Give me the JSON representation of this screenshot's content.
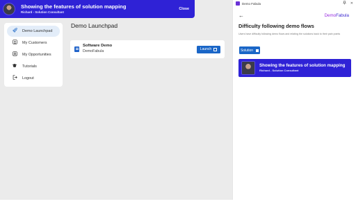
{
  "banner": {
    "title": "Showing the features of solution mapping",
    "subtitle": "Richard - Solution Consultant",
    "close_label": "Close"
  },
  "sidebar": {
    "items": [
      {
        "label": "Demo Launchpad",
        "icon": "rocket-icon",
        "active": true
      },
      {
        "label": "My Customers",
        "icon": "customers-icon",
        "active": false
      },
      {
        "label": "My Opportunities",
        "icon": "opportunities-icon",
        "active": false
      },
      {
        "label": "Tutorials",
        "icon": "graduation-cap-icon",
        "active": false
      },
      {
        "label": "Logout",
        "icon": "logout-icon",
        "active": false
      }
    ]
  },
  "main": {
    "title": "Demo Launchpad",
    "demos": [
      {
        "name": "Software Demo",
        "company": "DemoFabula",
        "launch_label": "Launch"
      }
    ]
  },
  "panel": {
    "app_name": "Demo Fabula",
    "brand_part1": "Demo",
    "brand_part2": "Fabula",
    "title": "Difficulty following demo flows",
    "description": "Users have difficulty following demo flows and relating the solutions back to their pain points",
    "solution_label": "Solution",
    "feature_card": {
      "title": "Showing the features of solution mapping",
      "subtitle": "Richard - Solution Consultant"
    }
  },
  "colors": {
    "accent": "#2f22d6",
    "button": "#1a66c7",
    "brand_purple": "#9a2be0"
  }
}
